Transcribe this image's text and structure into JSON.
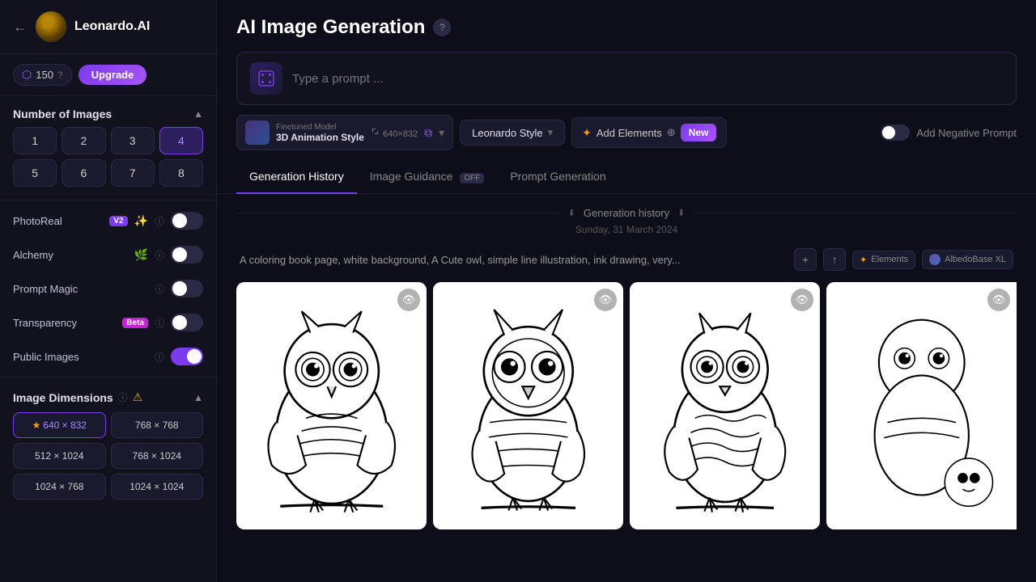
{
  "sidebar": {
    "back_icon": "←",
    "brand": "Leonardo.AI",
    "credits": "150",
    "credits_icon": "⬡",
    "upgrade_label": "Upgrade",
    "num_images": {
      "title": "Number of Images",
      "values": [
        1,
        2,
        3,
        4,
        5,
        6,
        7,
        8
      ],
      "active": 4
    },
    "photoreal": {
      "label": "PhotoReal",
      "badge": "V2",
      "enabled": false
    },
    "alchemy": {
      "label": "Alchemy",
      "enabled": false
    },
    "prompt_magic": {
      "label": "Prompt Magic",
      "enabled": false
    },
    "transparency": {
      "label": "Transparency",
      "badge": "Beta",
      "enabled": false
    },
    "public_images": {
      "label": "Public Images",
      "enabled": true
    },
    "image_dimensions": {
      "title": "Image Dimensions",
      "options": [
        {
          "label": "640 × 832",
          "active": true,
          "starred": true
        },
        {
          "label": "768 × 768",
          "active": false,
          "starred": false
        },
        {
          "label": "512 × 1024",
          "active": false,
          "starred": false
        },
        {
          "label": "768 × 1024",
          "active": false,
          "starred": false
        },
        {
          "label": "1024 × 768",
          "active": false,
          "starred": false
        },
        {
          "label": "1024 × 1024",
          "active": false,
          "starred": false
        }
      ]
    }
  },
  "header": {
    "title": "AI Image Generation",
    "prompt_placeholder": "Type a prompt ...",
    "model": {
      "label": "Finetuned Model",
      "size": "640×832",
      "name": "3D Animation Style"
    },
    "style": "Leonardo Style",
    "elements_label": "Add Elements",
    "new_label": "New",
    "neg_prompt_label": "Add Negative Prompt"
  },
  "tabs": [
    {
      "label": "Generation History",
      "active": true
    },
    {
      "label": "Image Guidance",
      "badge": "OFF",
      "active": false
    },
    {
      "label": "Prompt Generation",
      "active": false
    }
  ],
  "content": {
    "history_label": "Generation history",
    "date": "Sunday, 31 March 2024",
    "prompt_text": "A coloring book page, white background, A Cute owl, simple line illustration, ink drawing, very...",
    "elements_tag": "Elements",
    "model_tag": "AlbedoBase XL",
    "images": [
      {
        "id": 1,
        "type": "owl1"
      },
      {
        "id": 2,
        "type": "owl2"
      },
      {
        "id": 3,
        "type": "owl3"
      },
      {
        "id": 4,
        "type": "partial"
      }
    ]
  }
}
